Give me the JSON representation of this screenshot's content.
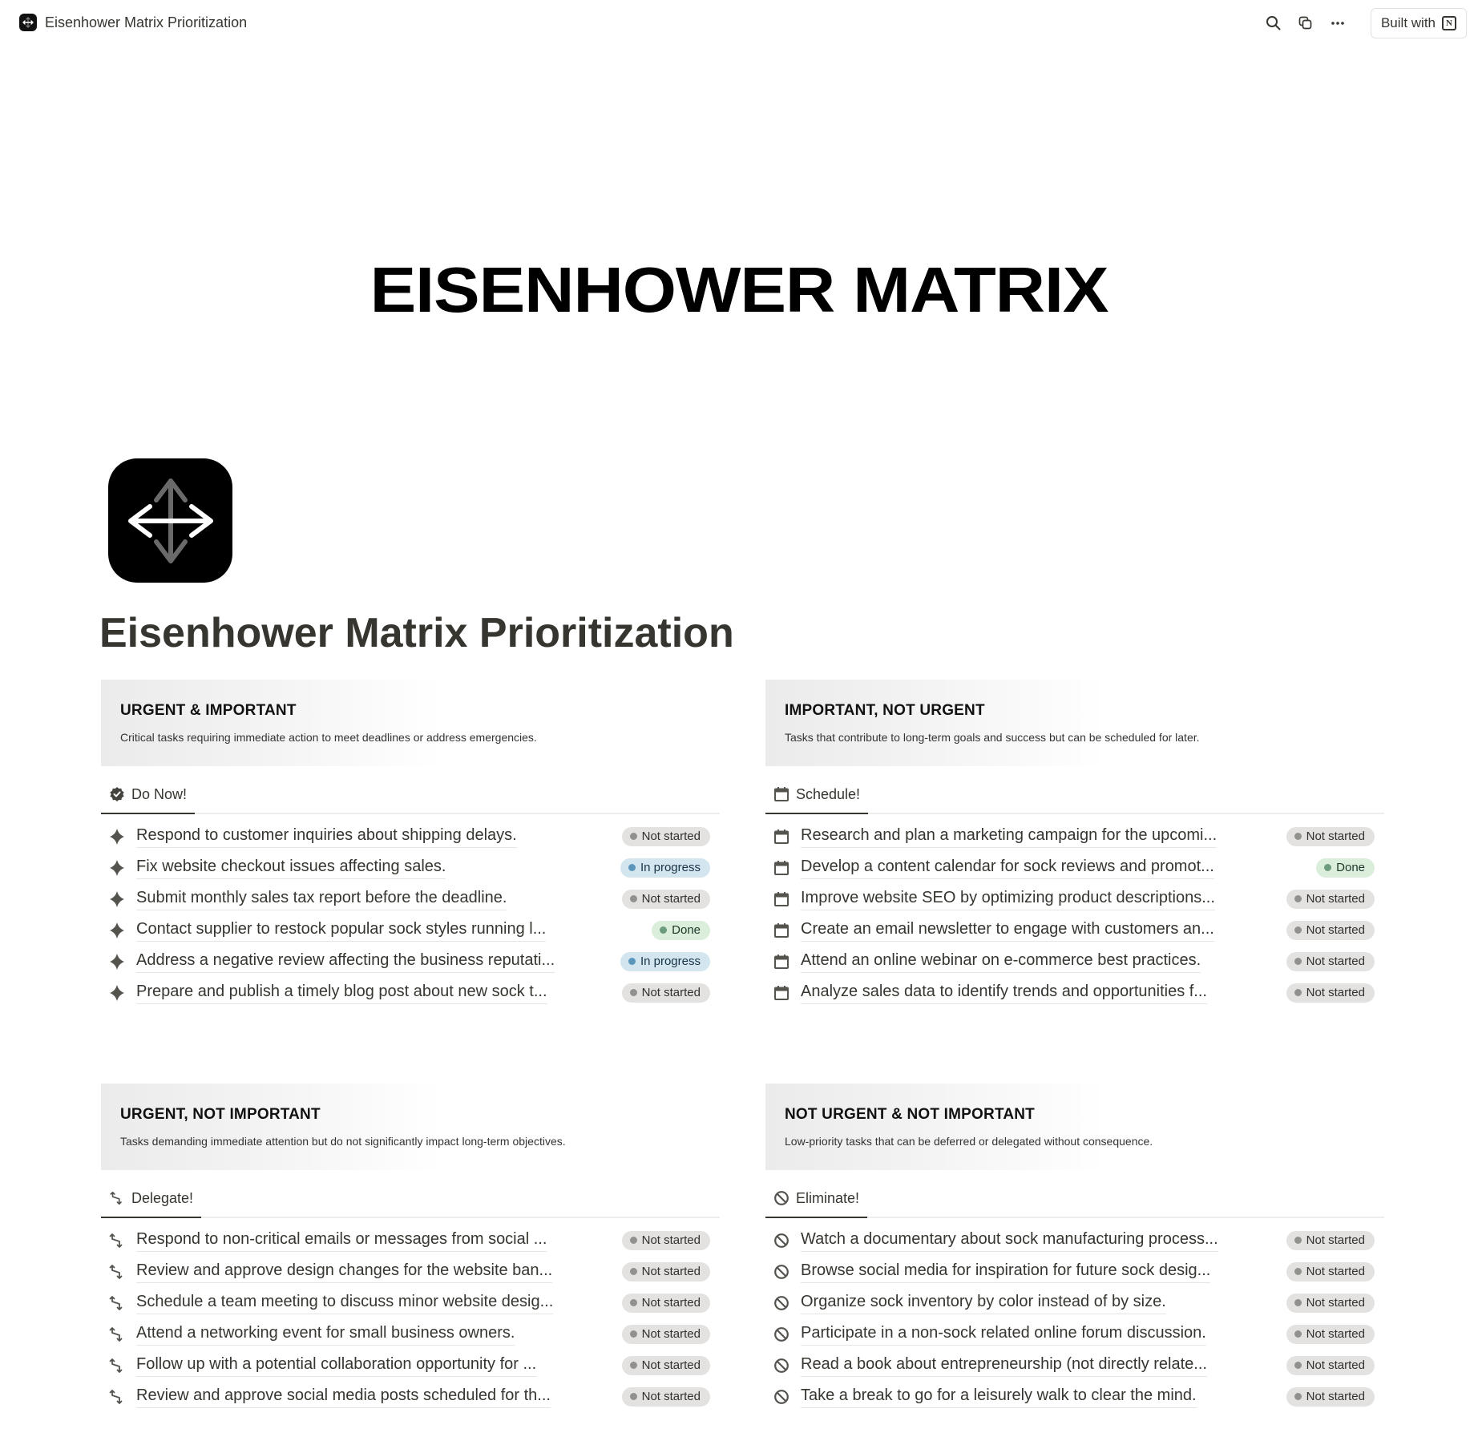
{
  "topbar": {
    "page_title": "Eisenhower Matrix Prioritization",
    "icons": [
      "search-icon",
      "duplicate-icon",
      "more-icon"
    ],
    "built_with_label": "Built with",
    "built_with_logo": "N"
  },
  "cover": {
    "title": "EISENHOWER MATRIX"
  },
  "page": {
    "icon": "eisenhower-arrows-icon",
    "title": "Eisenhower Matrix Prioritization"
  },
  "status_colors": {
    "Not started": "#e3e2e0",
    "In progress": "#d3e5ef",
    "Done": "#dbeddb"
  },
  "quadrants": [
    {
      "title": "URGENT & IMPORTANT",
      "description": "Critical tasks requiring immediate action to meet deadlines or address emergencies.",
      "tab": {
        "label": "Do Now!",
        "icon": "verified-badge-icon"
      },
      "row_icon": "diamond-icon",
      "tasks": [
        {
          "name": "Respond to customer inquiries about shipping delays.",
          "status": "Not started"
        },
        {
          "name": "Fix website checkout issues affecting sales.",
          "status": "In progress"
        },
        {
          "name": "Submit monthly sales tax report before the deadline.",
          "status": "Not started"
        },
        {
          "name": "Contact supplier to restock popular sock styles running l...",
          "status": "Done"
        },
        {
          "name": "Address a negative review affecting the business reputati...",
          "status": "In progress"
        },
        {
          "name": "Prepare and publish a timely blog post about new sock t...",
          "status": "Not started"
        }
      ]
    },
    {
      "title": "IMPORTANT, NOT URGENT",
      "description": "Tasks that contribute to long-term goals and success but can be scheduled for later.",
      "tab": {
        "label": "Schedule!",
        "icon": "calendar-icon"
      },
      "row_icon": "calendar-icon",
      "tasks": [
        {
          "name": "Research and plan a marketing campaign for the upcomi...",
          "status": "Not started"
        },
        {
          "name": "Develop a content calendar for sock reviews and promot...",
          "status": "Done"
        },
        {
          "name": "Improve website SEO by optimizing product descriptions...",
          "status": "Not started"
        },
        {
          "name": "Create an email newsletter to engage with customers an...",
          "status": "Not started"
        },
        {
          "name": "Attend an online webinar on e-commerce best practices.",
          "status": "Not started"
        },
        {
          "name": "Analyze sales data to identify trends and opportunities f...",
          "status": "Not started"
        }
      ]
    },
    {
      "title": "URGENT, NOT IMPORTANT",
      "description": "Tasks demanding immediate attention but do not significantly impact long-term objectives.",
      "tab": {
        "label": "Delegate!",
        "icon": "delegate-arrows-icon"
      },
      "row_icon": "delegate-arrows-icon",
      "tasks": [
        {
          "name": "Respond to non-critical emails or messages from social ...",
          "status": "Not started"
        },
        {
          "name": "Review and approve design changes for the website ban...",
          "status": "Not started"
        },
        {
          "name": "Schedule a team meeting to discuss minor website desig...",
          "status": "Not started"
        },
        {
          "name": "Attend a networking event for small business owners.",
          "status": "Not started"
        },
        {
          "name": "Follow up with a potential collaboration opportunity for ...",
          "status": "Not started"
        },
        {
          "name": "Review and approve social media posts scheduled for th...",
          "status": "Not started"
        }
      ]
    },
    {
      "title": "NOT URGENT & NOT IMPORTANT",
      "description": "Low-priority tasks that can be deferred or delegated without consequence.",
      "tab": {
        "label": "Eliminate!",
        "icon": "prohibited-icon"
      },
      "row_icon": "prohibited-icon",
      "tasks": [
        {
          "name": "Watch a documentary about sock manufacturing process...",
          "status": "Not started"
        },
        {
          "name": "Browse social media for inspiration for future sock desig...",
          "status": "Not started"
        },
        {
          "name": "Organize sock inventory by color instead of by size.",
          "status": "Not started"
        },
        {
          "name": "Participate in a non-sock related online forum discussion.",
          "status": "Not started"
        },
        {
          "name": "Read a book about entrepreneurship (not directly relate...",
          "status": "Not started"
        },
        {
          "name": "Take a break to go for a leisurely walk to clear the mind.",
          "status": "Not started"
        }
      ]
    }
  ]
}
